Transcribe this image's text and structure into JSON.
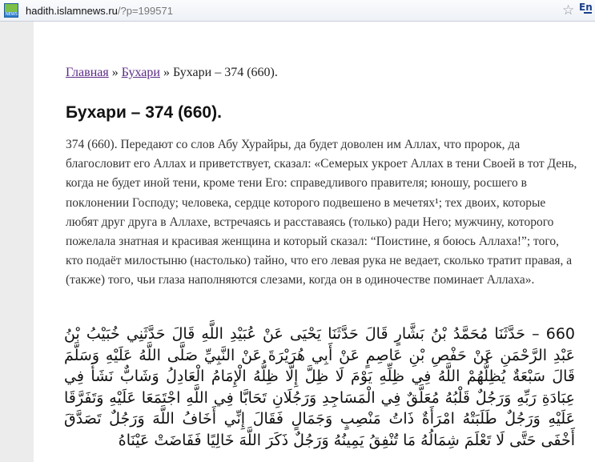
{
  "browser": {
    "url_host": "hadith.islamnews.ru",
    "url_path": "/?p=199571",
    "bookmark_icon": "star-icon",
    "language_button": "En"
  },
  "breadcrumb": {
    "home": "Главная",
    "sep1": " » ",
    "category": "Бухари",
    "sep2": " » ",
    "current": "Бухари – 374 (660)."
  },
  "article": {
    "title": "Бухари – 374 (660).",
    "body": "374 (660). Передают со слов Абу Хурайры, да будет доволен им Аллах, что пророк, да благословит его Аллах и приветствует, сказал: «Семерых укроет Аллах в тени Своей в тот День, когда не будет иной тени, кроме тени Его: справедливого правителя; юношу, росшего в поклонении Господу; человека, сердце которого подвешено в мечетях¹; тех двоих, которые любят друг друга в Аллахе, встречаясь и расставаясь (только) ради Него; мужчину, которого пожелала знатная и красивая женщина и который сказал: “Поистине, я боюсь Аллаха!”; того, кто подаёт милостыню (настолько) тайно, что его левая рука не ведает, сколько тратит правая, а (также) того, чьи глаза наполняются слезами, когда он в одиночестве поминает Аллаха».",
    "arabic": "660 – حَدَّثَنَا مُحَمَّدُ بْنُ بَشَّارٍ قَالَ حَدَّثَنَا يَحْيَى عَنْ عُبَيْدِ اللَّهِ قَالَ حَدَّثَنِي خُبَيْبُ بْنُ عَبْدِ الرَّحْمَنِ عَنْ حَفْصِ بْنِ عَاصِمٍ عَنْ أَبِي هُرَيْرَةَ عَنْ النَّبِيِّ صَلَّى اللَّهُ عَلَيْهِ وَسَلَّمَ قَالَ سَبْعَةٌ يُظِلُّهُمْ اللَّهُ فِي ظِلِّهِ يَوْمَ لَا ظِلَّ إِلَّا ظِلُّهُ الْإِمَامُ الْعَادِلُ وَشَابٌّ نَشَأَ فِي عِبَادَةِ رَبِّهِ وَرَجُلٌ قَلْبُهُ مُعَلَّقٌ فِي الْمَسَاجِدِ وَرَجُلَانِ تَحَابَّا فِي اللَّهِ اجْتَمَعَا عَلَيْهِ وَتَفَرَّقَا عَلَيْهِ وَرَجُلٌ طَلَبَتْهُ امْرَأَةٌ ذَاتُ مَنْصِبٍ وَجَمَالٍ فَقَالَ إِنِّي أَخَافُ اللَّهَ وَرَجُلٌ تَصَدَّقَ أَخْفَى حَتَّى لَا تَعْلَمَ شِمَالُهُ مَا تُنْفِقُ يَمِينُهُ وَرَجُلٌ ذَكَرَ اللَّهَ خَالِيًا فَفَاضَتْ عَيْنَاهُ"
  },
  "colors": {
    "link": "#5b2a86",
    "text": "#333333",
    "page_bg": "#ffffff",
    "outer_bg": "#ececec"
  }
}
